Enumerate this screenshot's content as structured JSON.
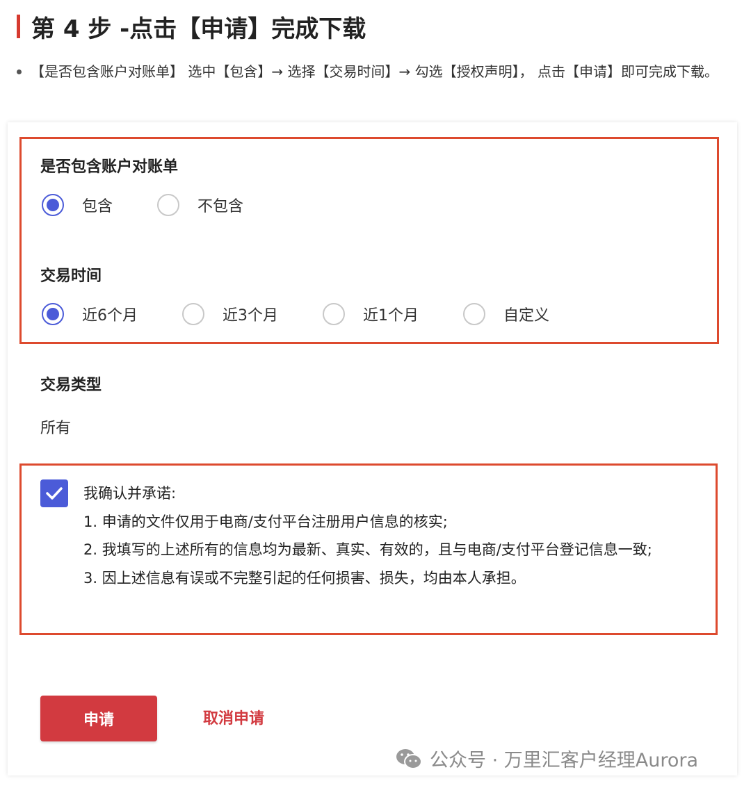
{
  "header": {
    "title_prefix": "第 4 步 - ",
    "title_main": "点击【申请】完成下载"
  },
  "instruction": "【是否包含账户对账单】 选中【包含】→ 选择【交易时间】→ 勾选【授权声明】， 点击【申请】即可完成下载。",
  "form": {
    "statement": {
      "label": "是否包含账户对账单",
      "options": [
        "包含",
        "不包含"
      ],
      "selected": "包含"
    },
    "period": {
      "label": "交易时间",
      "options": [
        "近6个月",
        "近3个月",
        "近1个月",
        "自定义"
      ],
      "selected": "近6个月"
    },
    "type": {
      "label": "交易类型",
      "value": "所有"
    },
    "consent": {
      "checked": true,
      "lines": [
        "我确认并承诺:",
        "1. 申请的文件仅用于电商/支付平台注册用户信息的核实;",
        "2. 我填写的上述所有的信息均为最新、真实、有效的，且与电商/支付平台登记信息一致;",
        "3. 因上述信息有误或不完整引起的任何损害、损失，均由本人承担。"
      ]
    }
  },
  "actions": {
    "apply_label": "申请",
    "cancel_label": "取消申请"
  },
  "watermark": "公众号 · 万里汇客户经理Aurora",
  "colors": {
    "accent_blue": "#4b5bd8",
    "primary_red": "#d23a40",
    "highlight_border": "#dd4a2e"
  }
}
